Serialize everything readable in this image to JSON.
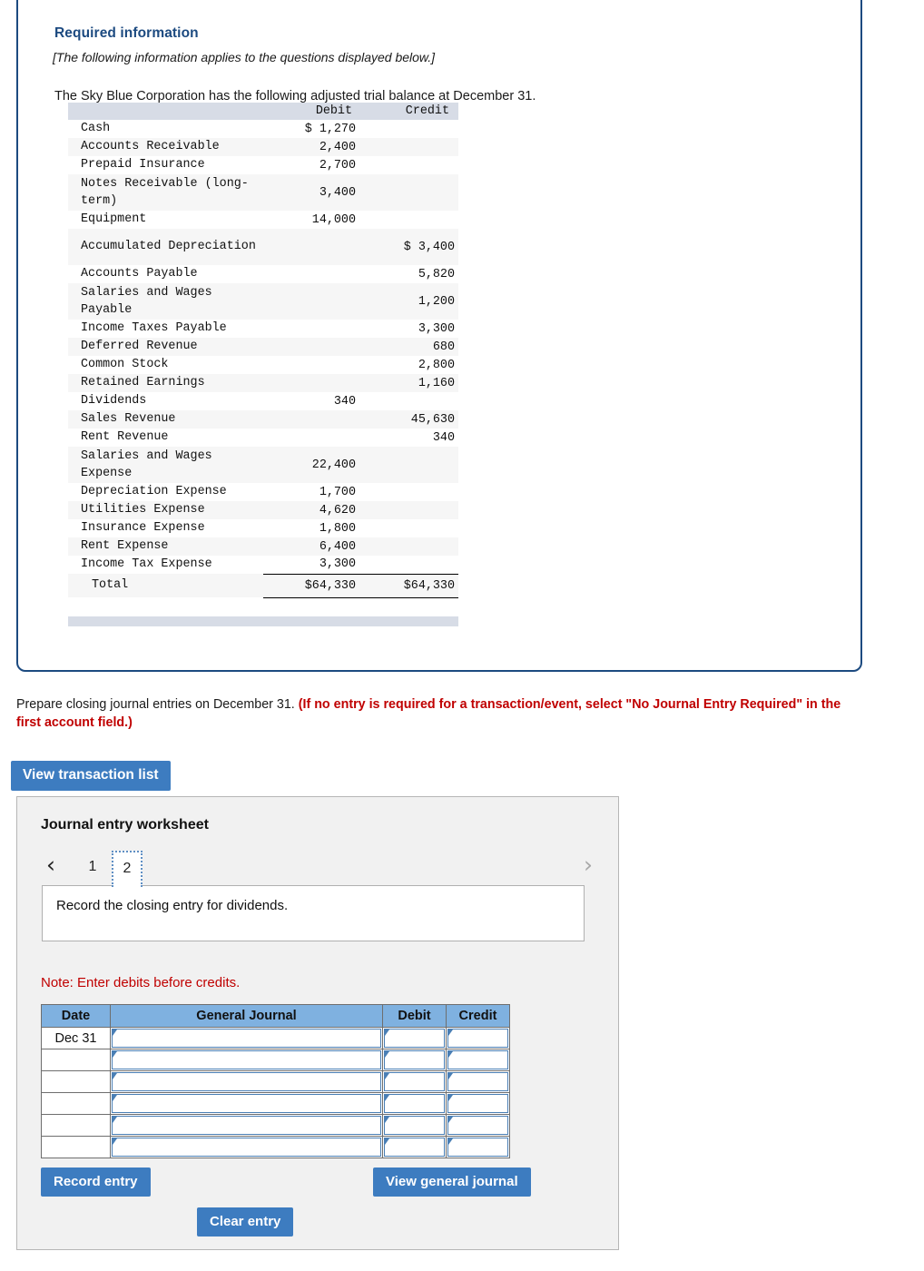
{
  "required_info": {
    "title": "Required information",
    "subtitle": "[The following information applies to the questions displayed below.]",
    "lead": "The Sky Blue Corporation has the following adjusted trial balance at December 31."
  },
  "trial_balance": {
    "columns": {
      "account": "",
      "debit": "Debit",
      "credit": "Credit"
    },
    "rows": [
      {
        "account": "Cash",
        "debit": "$ 1,270",
        "credit": ""
      },
      {
        "account": "Accounts Receivable",
        "debit": "2,400",
        "credit": ""
      },
      {
        "account": "Prepaid Insurance",
        "debit": "2,700",
        "credit": ""
      },
      {
        "account": "Notes Receivable (long-term)",
        "debit": "3,400",
        "credit": ""
      },
      {
        "account": "Equipment",
        "debit": "14,000",
        "credit": ""
      },
      {
        "account": "Accumulated Depreciation",
        "debit": "",
        "credit": "$ 3,400"
      },
      {
        "account": "Accounts Payable",
        "debit": "",
        "credit": "5,820"
      },
      {
        "account": "Salaries and Wages Payable",
        "debit": "",
        "credit": "1,200"
      },
      {
        "account": "Income Taxes Payable",
        "debit": "",
        "credit": "3,300"
      },
      {
        "account": "Deferred Revenue",
        "debit": "",
        "credit": "680"
      },
      {
        "account": "Common Stock",
        "debit": "",
        "credit": "2,800"
      },
      {
        "account": "Retained Earnings",
        "debit": "",
        "credit": "1,160"
      },
      {
        "account": "Dividends",
        "debit": "340",
        "credit": ""
      },
      {
        "account": "Sales Revenue",
        "debit": "",
        "credit": "45,630"
      },
      {
        "account": "Rent Revenue",
        "debit": "",
        "credit": "340"
      },
      {
        "account": "Salaries and Wages Expense",
        "debit": "22,400",
        "credit": ""
      },
      {
        "account": "Depreciation Expense",
        "debit": "1,700",
        "credit": ""
      },
      {
        "account": "Utilities Expense",
        "debit": "4,620",
        "credit": ""
      },
      {
        "account": "Insurance Expense",
        "debit": "1,800",
        "credit": ""
      },
      {
        "account": "Rent Expense",
        "debit": "6,400",
        "credit": ""
      },
      {
        "account": "Income Tax Expense",
        "debit": "3,300",
        "credit": ""
      }
    ],
    "total": {
      "label": "Total",
      "debit": "$64,330",
      "credit": "$64,330"
    }
  },
  "instruction": {
    "plain": "Prepare closing journal entries on December 31. ",
    "emphasis": "(If no entry is required for a transaction/event, select \"No Journal Entry Required\" in the first account field.)"
  },
  "buttons": {
    "view_transaction_list": "View transaction list",
    "record_entry": "Record entry",
    "clear_entry": "Clear entry",
    "view_general_journal": "View general journal"
  },
  "worksheet": {
    "title": "Journal entry worksheet",
    "pager": {
      "prev": "‹",
      "next": "›",
      "pages": [
        "1",
        "2"
      ],
      "active": "2"
    },
    "prompt": "Record the closing entry for dividends.",
    "note": "Note: Enter debits before credits.",
    "journal_table": {
      "headers": {
        "date": "Date",
        "general_journal": "General Journal",
        "debit": "Debit",
        "credit": "Credit"
      },
      "rows": [
        {
          "date": "Dec 31",
          "general_journal": "",
          "debit": "",
          "credit": ""
        },
        {
          "date": "",
          "general_journal": "",
          "debit": "",
          "credit": ""
        },
        {
          "date": "",
          "general_journal": "",
          "debit": "",
          "credit": ""
        },
        {
          "date": "",
          "general_journal": "",
          "debit": "",
          "credit": ""
        },
        {
          "date": "",
          "general_journal": "",
          "debit": "",
          "credit": ""
        },
        {
          "date": "",
          "general_journal": "",
          "debit": "",
          "credit": ""
        }
      ]
    }
  },
  "colors": {
    "panel_border": "#1c4a80",
    "heading_blue": "#1c4a80",
    "alert_red": "#c00000",
    "button_blue": "#3d7cc0",
    "table_header_band": "#d7dce6",
    "journal_header_blue": "#7fb1e0"
  }
}
